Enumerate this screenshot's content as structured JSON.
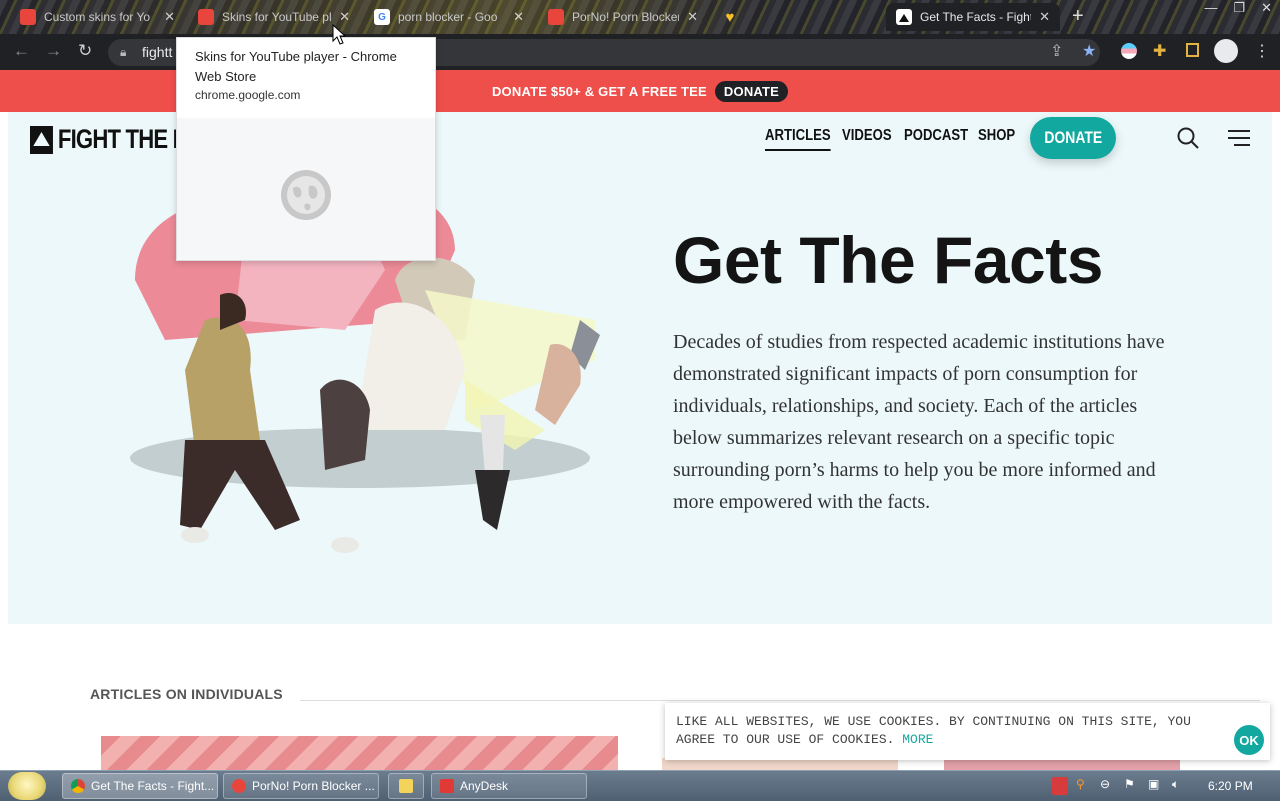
{
  "browser": {
    "tabs": [
      {
        "title": "Custom skins for Yo",
        "favicon_color": "#e8453c"
      },
      {
        "title": "Skins for YouTube player",
        "favicon_color": "#e8453c"
      },
      {
        "title": "porn blocker - Goo",
        "favicon_color": "#4285f4"
      },
      {
        "title": "PorNo! Porn Blocker",
        "favicon_color": "#e8453c"
      },
      {
        "title": "",
        "favicon_color": "#f6c026"
      },
      {
        "title": "Get The Facts - Fight",
        "favicon_color": "#ffffff"
      }
    ],
    "new_tab": "+",
    "url": "fightt",
    "window_controls": [
      "—",
      "❐",
      "✕"
    ]
  },
  "tooltip": {
    "title": "Skins for YouTube player - Chrome Web Store",
    "domain": "chrome.google.com"
  },
  "site": {
    "banner": {
      "text": "DONATE $50+ & GET A FREE TEE",
      "button": "DONATE"
    },
    "logo": "FIGHT THE NE",
    "nav": [
      "ARTICLES",
      "VIDEOS",
      "PODCAST",
      "SHOP"
    ],
    "donate_button": "DONATE",
    "hero": {
      "title": "Get The Facts",
      "body": "Decades of studies from respected academic institutions have demonstrated significant impacts of porn consumption for individuals, relationships, and society. Each of the articles below summarizes relevant research on a specific topic surrounding porn’s harms to help you be more informed and more empowered with the facts."
    },
    "section_title": "ARTICLES ON INDIVIDUALS",
    "cookie": {
      "text": "LIKE ALL WEBSITES, WE USE COOKIES. BY CONTINUING ON THIS SITE, YOU AGREE TO OUR USE OF COOKIES.",
      "more": "MORE",
      "ok": "OK"
    },
    "accent_color": "#12a8a0",
    "banner_color": "#ef4f4b"
  },
  "taskbar": {
    "buttons": [
      {
        "label": "Get The Facts - Fight..."
      },
      {
        "label": "PorNo! Porn Blocker ..."
      },
      {
        "label": ""
      },
      {
        "label": "AnyDesk"
      }
    ],
    "clock": "6:20 PM"
  }
}
